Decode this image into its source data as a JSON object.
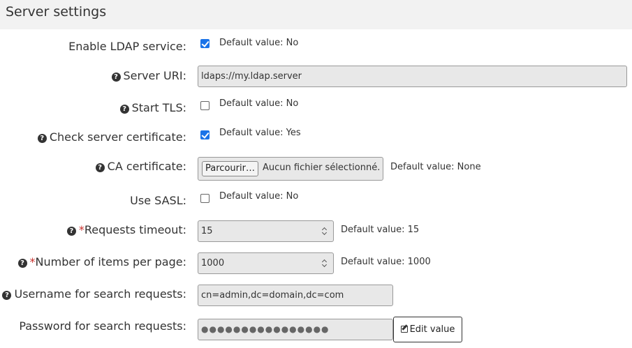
{
  "section_title": "Server settings",
  "fields": {
    "enable_ldap": {
      "label": "Enable LDAP service:",
      "checked": true,
      "default": "Default value: No"
    },
    "server_uri": {
      "label": "Server URI:",
      "value": "ldaps://my.ldap.server"
    },
    "start_tls": {
      "label": "Start TLS:",
      "checked": false,
      "default": "Default value: No"
    },
    "check_cert": {
      "label": "Check server certificate:",
      "checked": true,
      "default": "Default value: Yes"
    },
    "ca_cert": {
      "label": "CA certificate:",
      "browse_label": "Parcourir…",
      "file_status": "Aucun fichier sélectionné.",
      "default": "Default value: None"
    },
    "use_sasl": {
      "label": "Use SASL:",
      "checked": false,
      "default": "Default value: No"
    },
    "timeout": {
      "required_mark": "*",
      "label": "Requests timeout:",
      "value": "15",
      "default": "Default value: 15"
    },
    "items_per_page": {
      "required_mark": "*",
      "label": "Number of items per page:",
      "value": "1000",
      "default": "Default value: 1000"
    },
    "username": {
      "label": "Username for search requests:",
      "value": "cn=admin,dc=domain,dc=com"
    },
    "password": {
      "label": "Password for search requests:",
      "masked_value": "●●●●●●●●●●●●●●●●",
      "edit_label": "Edit value"
    }
  },
  "icons": {
    "help": "question-circle-icon",
    "edit": "edit-icon"
  }
}
